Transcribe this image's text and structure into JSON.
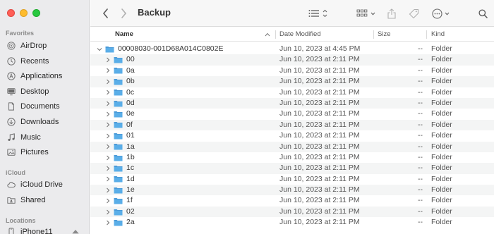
{
  "window": {
    "title": "Backup"
  },
  "sidebar": {
    "favorites_label": "Favorites",
    "favorites": [
      {
        "label": "AirDrop",
        "icon": "airdrop-icon"
      },
      {
        "label": "Recents",
        "icon": "clock-icon"
      },
      {
        "label": "Applications",
        "icon": "applications-icon"
      },
      {
        "label": "Desktop",
        "icon": "desktop-icon"
      },
      {
        "label": "Documents",
        "icon": "document-icon"
      },
      {
        "label": "Downloads",
        "icon": "download-icon"
      },
      {
        "label": "Music",
        "icon": "music-icon"
      },
      {
        "label": "Pictures",
        "icon": "pictures-icon"
      }
    ],
    "icloud_label": "iCloud",
    "icloud": [
      {
        "label": "iCloud Drive",
        "icon": "cloud-icon"
      },
      {
        "label": "Shared",
        "icon": "shared-folder-icon"
      }
    ],
    "locations_label": "Locations",
    "locations": [
      {
        "label": "iPhone11",
        "icon": "iphone-icon"
      }
    ]
  },
  "columns": {
    "name": "Name",
    "date": "Date Modified",
    "size": "Size",
    "kind": "Kind"
  },
  "rows": [
    {
      "name": "00008030-001D68A014C0802E",
      "date": "Jun 10, 2023 at 4:45 PM",
      "size": "--",
      "kind": "Folder",
      "expanded": true,
      "level": 0
    },
    {
      "name": "00",
      "date": "Jun 10, 2023 at 2:11 PM",
      "size": "--",
      "kind": "Folder",
      "level": 1
    },
    {
      "name": "0a",
      "date": "Jun 10, 2023 at 2:11 PM",
      "size": "--",
      "kind": "Folder",
      "level": 1
    },
    {
      "name": "0b",
      "date": "Jun 10, 2023 at 2:11 PM",
      "size": "--",
      "kind": "Folder",
      "level": 1
    },
    {
      "name": "0c",
      "date": "Jun 10, 2023 at 2:11 PM",
      "size": "--",
      "kind": "Folder",
      "level": 1
    },
    {
      "name": "0d",
      "date": "Jun 10, 2023 at 2:11 PM",
      "size": "--",
      "kind": "Folder",
      "level": 1
    },
    {
      "name": "0e",
      "date": "Jun 10, 2023 at 2:11 PM",
      "size": "--",
      "kind": "Folder",
      "level": 1
    },
    {
      "name": "0f",
      "date": "Jun 10, 2023 at 2:11 PM",
      "size": "--",
      "kind": "Folder",
      "level": 1
    },
    {
      "name": "01",
      "date": "Jun 10, 2023 at 2:11 PM",
      "size": "--",
      "kind": "Folder",
      "level": 1
    },
    {
      "name": "1a",
      "date": "Jun 10, 2023 at 2:11 PM",
      "size": "--",
      "kind": "Folder",
      "level": 1
    },
    {
      "name": "1b",
      "date": "Jun 10, 2023 at 2:11 PM",
      "size": "--",
      "kind": "Folder",
      "level": 1
    },
    {
      "name": "1c",
      "date": "Jun 10, 2023 at 2:11 PM",
      "size": "--",
      "kind": "Folder",
      "level": 1
    },
    {
      "name": "1d",
      "date": "Jun 10, 2023 at 2:11 PM",
      "size": "--",
      "kind": "Folder",
      "level": 1
    },
    {
      "name": "1e",
      "date": "Jun 10, 2023 at 2:11 PM",
      "size": "--",
      "kind": "Folder",
      "level": 1
    },
    {
      "name": "1f",
      "date": "Jun 10, 2023 at 2:11 PM",
      "size": "--",
      "kind": "Folder",
      "level": 1
    },
    {
      "name": "02",
      "date": "Jun 10, 2023 at 2:11 PM",
      "size": "--",
      "kind": "Folder",
      "level": 1
    },
    {
      "name": "2a",
      "date": "Jun 10, 2023 at 2:11 PM",
      "size": "--",
      "kind": "Folder",
      "level": 1
    }
  ],
  "colors": {
    "folder": "#5aaee8",
    "folder_tab": "#4a9ad8",
    "sidebar_icon": "#6a6a6a"
  }
}
